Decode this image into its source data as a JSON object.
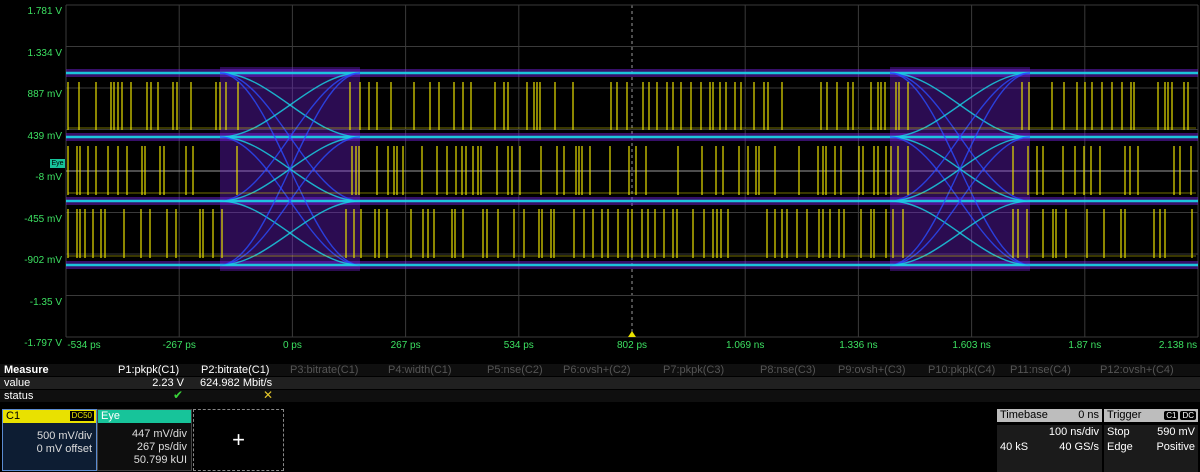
{
  "scope": {
    "y_labels": [
      "1.781 V",
      "1.334 V",
      "887 mV",
      "439 mV",
      "-8 mV",
      "-455 mV",
      "-902 mV",
      "-1.35 V",
      "-1.797 V"
    ],
    "x_labels": [
      "-534 ps",
      "-267 ps",
      "0 ps",
      "267 ps",
      "534 ps",
      "802 ps",
      "1.069 ns",
      "1.336 ns",
      "1.603 ns",
      "1.87 ns",
      "2.138 ns"
    ],
    "eye_marker_label": "Eye",
    "colors": {
      "grid": "#3a3a3a",
      "grid_center": "#9a9a9a",
      "c1_trace": "#e9e100",
      "eye_violet": "#7b22e8",
      "eye_blue": "#2b4cff",
      "eye_cyan": "#18d8e8",
      "label": "#3ce061"
    }
  },
  "measure": {
    "header": "Measure",
    "row_labels": [
      "value",
      "status"
    ],
    "params": [
      {
        "label": "P1:pkpk(C1)",
        "value": "2.23 V",
        "status": "✔",
        "active": true
      },
      {
        "label": "P2:bitrate(C1)",
        "value": "624.982 Mbit/s",
        "status": "✕",
        "active": true
      },
      {
        "label": "P3:bitrate(C1)",
        "value": "",
        "status": "",
        "active": false
      },
      {
        "label": "P4:width(C1)",
        "value": "",
        "status": "",
        "active": false
      },
      {
        "label": "P5:nse(C2)",
        "value": "",
        "status": "",
        "active": false
      },
      {
        "label": "P6:ovsh+(C2)",
        "value": "",
        "status": "",
        "active": false
      },
      {
        "label": "P7:pkpk(C3)",
        "value": "",
        "status": "",
        "active": false
      },
      {
        "label": "P8:nse(C3)",
        "value": "",
        "status": "",
        "active": false
      },
      {
        "label": "P9:ovsh+(C3)",
        "value": "",
        "status": "",
        "active": false
      },
      {
        "label": "P10:pkpk(C4)",
        "value": "",
        "status": "",
        "active": false
      },
      {
        "label": "P11:nse(C4)",
        "value": "",
        "status": "",
        "active": false
      },
      {
        "label": "P12:ovsh+(C4)",
        "value": "",
        "status": "",
        "active": false
      }
    ]
  },
  "c1": {
    "name": "C1",
    "badge": "DC50",
    "vdiv": "500 mV/div",
    "offset": "0 mV offset"
  },
  "eye": {
    "name": "Eye",
    "vdiv": "447 mV/div",
    "tdiv": "267 ps/div",
    "count": "50.799 kUI"
  },
  "add_label": "+",
  "timebase": {
    "title": "Timebase",
    "delay": "0 ns",
    "tdiv": "100 ns/div",
    "samples": "40 kS",
    "rate": "40 GS/s"
  },
  "trigger": {
    "title": "Trigger",
    "tag1": "C1",
    "tag2": "DC",
    "mode": "Stop",
    "level": "590 mV",
    "type": "Edge",
    "slope": "Positive"
  }
}
